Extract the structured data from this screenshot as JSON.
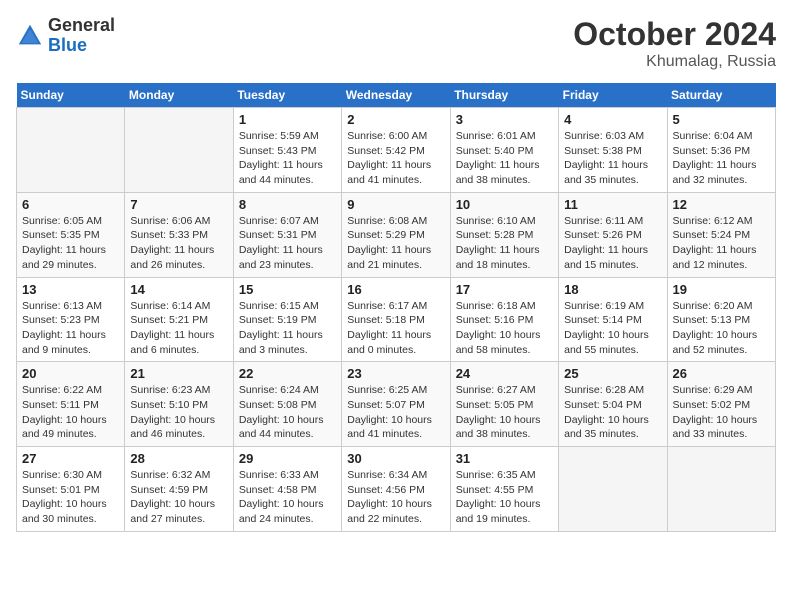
{
  "header": {
    "logo_line1": "General",
    "logo_line2": "Blue",
    "month_title": "October 2024",
    "location": "Khumalag, Russia"
  },
  "weekdays": [
    "Sunday",
    "Monday",
    "Tuesday",
    "Wednesday",
    "Thursday",
    "Friday",
    "Saturday"
  ],
  "weeks": [
    [
      {
        "day": "",
        "info": ""
      },
      {
        "day": "",
        "info": ""
      },
      {
        "day": "1",
        "info": "Sunrise: 5:59 AM\nSunset: 5:43 PM\nDaylight: 11 hours and 44 minutes."
      },
      {
        "day": "2",
        "info": "Sunrise: 6:00 AM\nSunset: 5:42 PM\nDaylight: 11 hours and 41 minutes."
      },
      {
        "day": "3",
        "info": "Sunrise: 6:01 AM\nSunset: 5:40 PM\nDaylight: 11 hours and 38 minutes."
      },
      {
        "day": "4",
        "info": "Sunrise: 6:03 AM\nSunset: 5:38 PM\nDaylight: 11 hours and 35 minutes."
      },
      {
        "day": "5",
        "info": "Sunrise: 6:04 AM\nSunset: 5:36 PM\nDaylight: 11 hours and 32 minutes."
      }
    ],
    [
      {
        "day": "6",
        "info": "Sunrise: 6:05 AM\nSunset: 5:35 PM\nDaylight: 11 hours and 29 minutes."
      },
      {
        "day": "7",
        "info": "Sunrise: 6:06 AM\nSunset: 5:33 PM\nDaylight: 11 hours and 26 minutes."
      },
      {
        "day": "8",
        "info": "Sunrise: 6:07 AM\nSunset: 5:31 PM\nDaylight: 11 hours and 23 minutes."
      },
      {
        "day": "9",
        "info": "Sunrise: 6:08 AM\nSunset: 5:29 PM\nDaylight: 11 hours and 21 minutes."
      },
      {
        "day": "10",
        "info": "Sunrise: 6:10 AM\nSunset: 5:28 PM\nDaylight: 11 hours and 18 minutes."
      },
      {
        "day": "11",
        "info": "Sunrise: 6:11 AM\nSunset: 5:26 PM\nDaylight: 11 hours and 15 minutes."
      },
      {
        "day": "12",
        "info": "Sunrise: 6:12 AM\nSunset: 5:24 PM\nDaylight: 11 hours and 12 minutes."
      }
    ],
    [
      {
        "day": "13",
        "info": "Sunrise: 6:13 AM\nSunset: 5:23 PM\nDaylight: 11 hours and 9 minutes."
      },
      {
        "day": "14",
        "info": "Sunrise: 6:14 AM\nSunset: 5:21 PM\nDaylight: 11 hours and 6 minutes."
      },
      {
        "day": "15",
        "info": "Sunrise: 6:15 AM\nSunset: 5:19 PM\nDaylight: 11 hours and 3 minutes."
      },
      {
        "day": "16",
        "info": "Sunrise: 6:17 AM\nSunset: 5:18 PM\nDaylight: 11 hours and 0 minutes."
      },
      {
        "day": "17",
        "info": "Sunrise: 6:18 AM\nSunset: 5:16 PM\nDaylight: 10 hours and 58 minutes."
      },
      {
        "day": "18",
        "info": "Sunrise: 6:19 AM\nSunset: 5:14 PM\nDaylight: 10 hours and 55 minutes."
      },
      {
        "day": "19",
        "info": "Sunrise: 6:20 AM\nSunset: 5:13 PM\nDaylight: 10 hours and 52 minutes."
      }
    ],
    [
      {
        "day": "20",
        "info": "Sunrise: 6:22 AM\nSunset: 5:11 PM\nDaylight: 10 hours and 49 minutes."
      },
      {
        "day": "21",
        "info": "Sunrise: 6:23 AM\nSunset: 5:10 PM\nDaylight: 10 hours and 46 minutes."
      },
      {
        "day": "22",
        "info": "Sunrise: 6:24 AM\nSunset: 5:08 PM\nDaylight: 10 hours and 44 minutes."
      },
      {
        "day": "23",
        "info": "Sunrise: 6:25 AM\nSunset: 5:07 PM\nDaylight: 10 hours and 41 minutes."
      },
      {
        "day": "24",
        "info": "Sunrise: 6:27 AM\nSunset: 5:05 PM\nDaylight: 10 hours and 38 minutes."
      },
      {
        "day": "25",
        "info": "Sunrise: 6:28 AM\nSunset: 5:04 PM\nDaylight: 10 hours and 35 minutes."
      },
      {
        "day": "26",
        "info": "Sunrise: 6:29 AM\nSunset: 5:02 PM\nDaylight: 10 hours and 33 minutes."
      }
    ],
    [
      {
        "day": "27",
        "info": "Sunrise: 6:30 AM\nSunset: 5:01 PM\nDaylight: 10 hours and 30 minutes."
      },
      {
        "day": "28",
        "info": "Sunrise: 6:32 AM\nSunset: 4:59 PM\nDaylight: 10 hours and 27 minutes."
      },
      {
        "day": "29",
        "info": "Sunrise: 6:33 AM\nSunset: 4:58 PM\nDaylight: 10 hours and 24 minutes."
      },
      {
        "day": "30",
        "info": "Sunrise: 6:34 AM\nSunset: 4:56 PM\nDaylight: 10 hours and 22 minutes."
      },
      {
        "day": "31",
        "info": "Sunrise: 6:35 AM\nSunset: 4:55 PM\nDaylight: 10 hours and 19 minutes."
      },
      {
        "day": "",
        "info": ""
      },
      {
        "day": "",
        "info": ""
      }
    ]
  ]
}
